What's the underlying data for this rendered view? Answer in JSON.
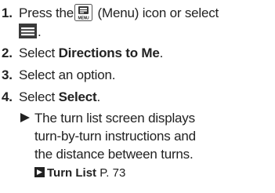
{
  "steps": [
    {
      "number": "1.",
      "text_before_icon": "Press the",
      "icon_caption": "MENU",
      "text_after_icon": " (Menu) icon or select",
      "icon2": "list-icon",
      "text_end": "."
    },
    {
      "number": "2.",
      "text_before": "Select ",
      "bold": "Directions to Me",
      "text_after": "."
    },
    {
      "number": "3.",
      "text": "Select an option."
    },
    {
      "number": "4.",
      "text_before": "Select ",
      "bold": "Select",
      "text_after": "."
    }
  ],
  "result": {
    "lines": [
      "The turn list screen displays",
      "turn-by-turn instructions and",
      "the distance between turns."
    ]
  },
  "reference": {
    "title": "Turn List",
    "page": "P. 73"
  },
  "colors": {
    "text": "#222222",
    "icon_fill": "#3a3a3a"
  }
}
